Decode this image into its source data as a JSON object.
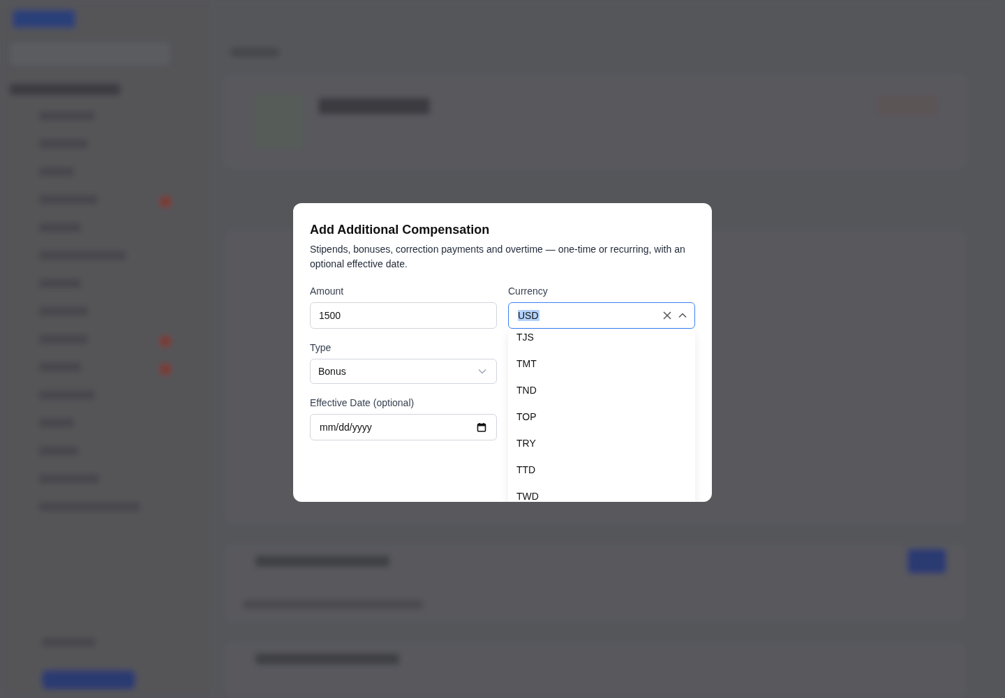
{
  "dialog": {
    "title": "Add Additional Compensation",
    "description": "Stipends, bonuses, correction payments and overtime — one-time or recurring, with an optional effective date.",
    "amount": {
      "label": "Amount",
      "value": "1500"
    },
    "currency": {
      "label": "Currency",
      "value": "USD",
      "value_selected": true,
      "expanded": true,
      "options": [
        {
          "label": "TJS",
          "selected": false
        },
        {
          "label": "TMT",
          "selected": false
        },
        {
          "label": "TND",
          "selected": false
        },
        {
          "label": "TOP",
          "selected": false
        },
        {
          "label": "TRY",
          "selected": false
        },
        {
          "label": "TTD",
          "selected": false
        },
        {
          "label": "TWD",
          "selected": false
        }
      ]
    },
    "type": {
      "label": "Type",
      "value": "Bonus"
    },
    "effective_date": {
      "label": "Effective Date (optional)",
      "placeholder": "mm/dd/yyyy"
    }
  }
}
